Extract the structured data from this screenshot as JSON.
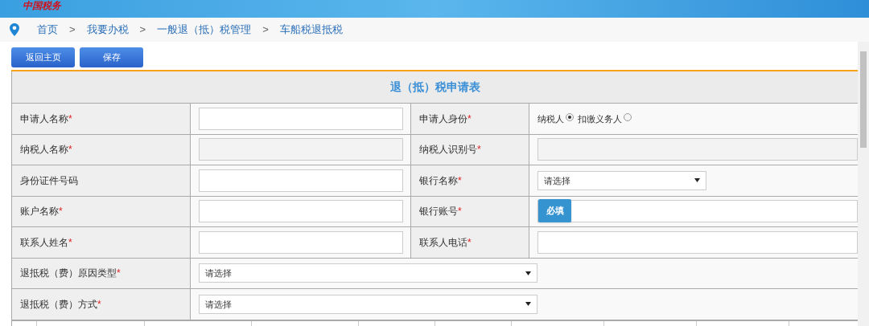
{
  "header": {
    "logo": "中国税务"
  },
  "breadcrumb": [
    "首页",
    "我要办税",
    "一般退（抵）税管理",
    "车船税退抵税"
  ],
  "breadcrumb_separator": ">",
  "buttons": [
    "返回主页",
    "保存"
  ],
  "form": {
    "title": "退（抵）税申请表",
    "rows": [
      {
        "cells": [
          {
            "label": "申请人名称",
            "required_mark": "*",
            "field": {
              "kind": "input"
            }
          },
          {
            "label": "申请人身份",
            "required_mark": "*",
            "field": {
              "kind": "radio",
              "options": [
                {
                  "label": "纳税人",
                  "selected": true
                },
                {
                  "label": "扣缴义务人",
                  "selected": false
                }
              ]
            }
          }
        ]
      },
      {
        "cells": [
          {
            "label": "纳税人名称",
            "required_mark": "*",
            "field": {
              "kind": "readonly"
            }
          },
          {
            "label": "纳税人识别号",
            "required_mark": "*",
            "field": {
              "kind": "readonly"
            }
          }
        ]
      },
      {
        "cells": [
          {
            "label": "身份证件号码",
            "field": {
              "kind": "input"
            }
          },
          {
            "label": "银行名称",
            "required_mark": "*",
            "field": {
              "kind": "select",
              "value": "请选择"
            }
          }
        ]
      },
      {
        "cells": [
          {
            "label": "账户名称",
            "required_mark": "*",
            "field": {
              "kind": "input"
            }
          },
          {
            "label": "银行账号",
            "required_mark": "*",
            "field": {
              "kind": "input",
              "tooltip": "必填"
            }
          }
        ]
      },
      {
        "cells": [
          {
            "label": "联系人姓名",
            "required_mark": "*",
            "field": {
              "kind": "input"
            }
          },
          {
            "label": "联系人电话",
            "required_mark": "*",
            "field": {
              "kind": "input"
            }
          }
        ]
      },
      {
        "cells": [
          {
            "label": "退抵税（费）原因类型",
            "required_mark": "*",
            "field": {
              "kind": "wideselect",
              "value": "请选择"
            }
          }
        ]
      },
      {
        "cells": [
          {
            "label": "退抵税（费）方式",
            "required_mark": "*",
            "field": {
              "kind": "wideselect",
              "value": "请选择"
            }
          }
        ]
      }
    ]
  }
}
